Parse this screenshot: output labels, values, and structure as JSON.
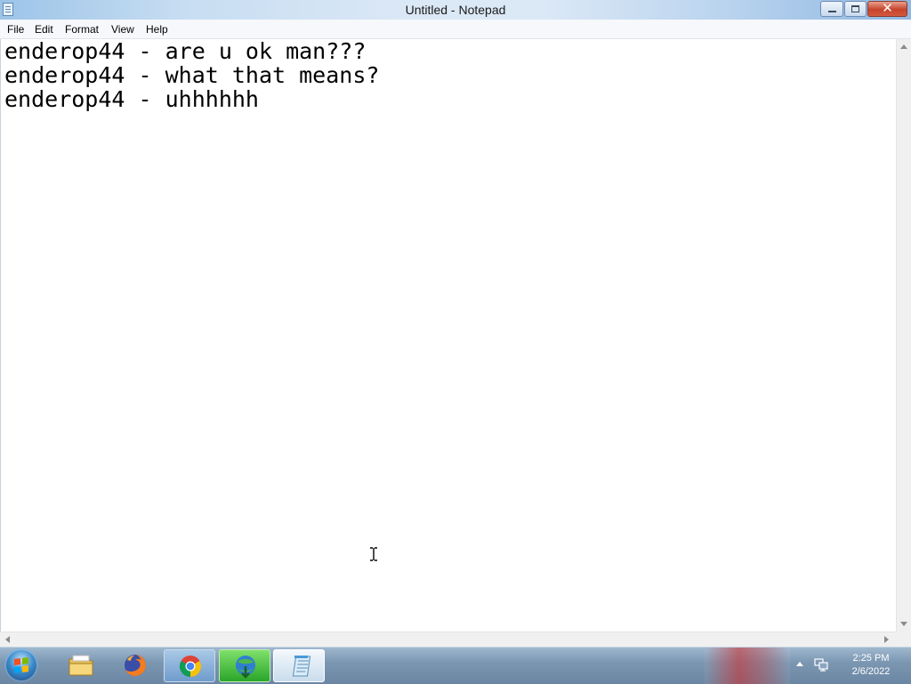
{
  "window": {
    "title": "Untitled - Notepad",
    "buttons": {
      "close_glyph": "✕"
    }
  },
  "menu": {
    "items": [
      {
        "label": "File"
      },
      {
        "label": "Edit"
      },
      {
        "label": "Format"
      },
      {
        "label": "View"
      },
      {
        "label": "Help"
      }
    ]
  },
  "editor": {
    "lines": [
      "enderop44 - are u ok man???",
      "enderop44 - what that means?",
      "enderop44 - uhhhhhh"
    ]
  },
  "taskbar": {
    "pinned": [
      {
        "icon": "folder-icon"
      },
      {
        "icon": "firefox-icon"
      },
      {
        "icon": "chrome-icon"
      },
      {
        "icon": "idm-icon"
      },
      {
        "icon": "notepad-icon"
      }
    ],
    "clock": {
      "time": "2:25 PM",
      "date": "2/6/2022"
    }
  },
  "colors": {
    "close_red": "#c7432b",
    "idm_green": "#2aa52a",
    "taskbar_blue": "#7c97b2"
  }
}
